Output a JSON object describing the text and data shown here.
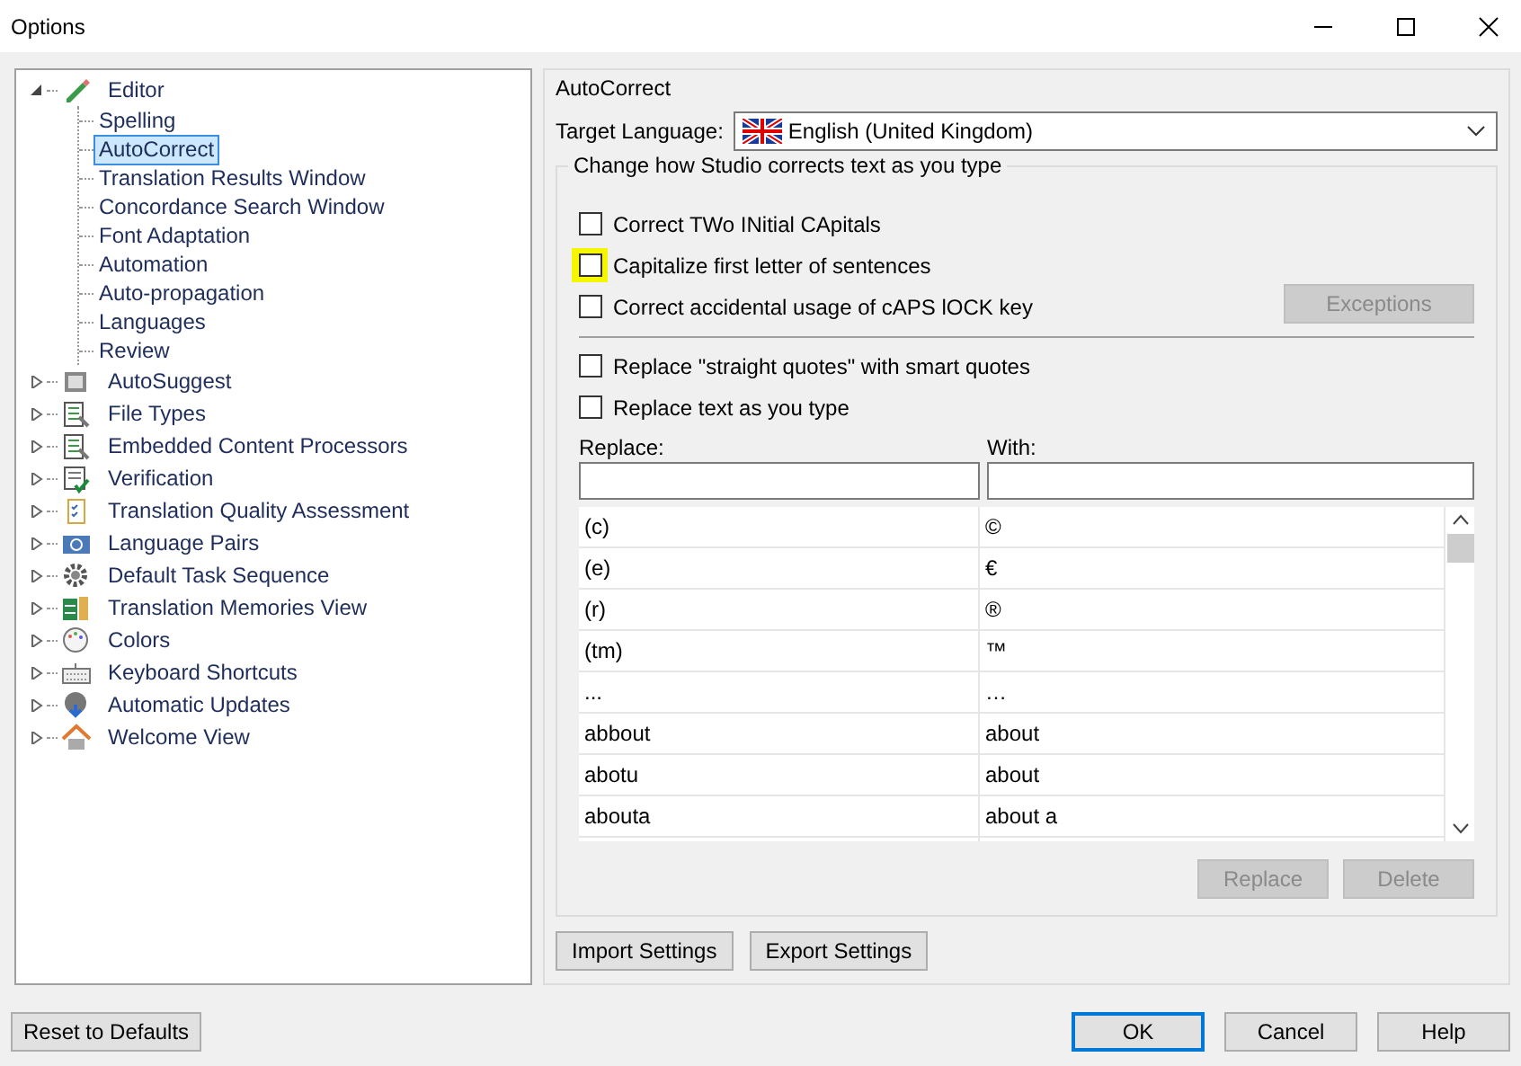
{
  "window": {
    "title": "Options"
  },
  "tree": [
    {
      "label": "Editor",
      "expanded": true,
      "selected": false,
      "children": [
        {
          "label": "Spelling",
          "selected": false
        },
        {
          "label": "AutoCorrect",
          "selected": true
        },
        {
          "label": "Translation Results Window",
          "selected": false
        },
        {
          "label": "Concordance Search Window",
          "selected": false
        },
        {
          "label": "Font Adaptation",
          "selected": false
        },
        {
          "label": "Automation",
          "selected": false
        },
        {
          "label": "Auto-propagation",
          "selected": false
        },
        {
          "label": "Languages",
          "selected": false
        },
        {
          "label": "Review",
          "selected": false
        }
      ]
    },
    {
      "label": "AutoSuggest",
      "expanded": false,
      "selected": false
    },
    {
      "label": "File Types",
      "expanded": false,
      "selected": false
    },
    {
      "label": "Embedded Content Processors",
      "expanded": false,
      "selected": false
    },
    {
      "label": "Verification",
      "expanded": false,
      "selected": false
    },
    {
      "label": "Translation Quality Assessment",
      "expanded": false,
      "selected": false
    },
    {
      "label": "Language Pairs",
      "expanded": false,
      "selected": false
    },
    {
      "label": "Default Task Sequence",
      "expanded": false,
      "selected": false
    },
    {
      "label": "Translation Memories View",
      "expanded": false,
      "selected": false
    },
    {
      "label": "Colors",
      "expanded": false,
      "selected": false
    },
    {
      "label": "Keyboard Shortcuts",
      "expanded": false,
      "selected": false
    },
    {
      "label": "Automatic Updates",
      "expanded": false,
      "selected": false
    },
    {
      "label": "Welcome View",
      "expanded": false,
      "selected": false
    }
  ],
  "autocorrect": {
    "title": "AutoCorrect",
    "target_language_label": "Target Language:",
    "target_language": "English (United Kingdom)",
    "group_title": "Change how Studio corrects text as you type",
    "options": [
      {
        "label": "Correct TWo INitial CApitals",
        "checked": false,
        "highlighted": false
      },
      {
        "label": "Capitalize first letter of sentences",
        "checked": false,
        "highlighted": true
      },
      {
        "label": "Correct accidental usage of cAPS lOCK key",
        "checked": false,
        "highlighted": false
      }
    ],
    "exceptions_button": {
      "label": "Exceptions",
      "disabled": true
    },
    "options_2": [
      {
        "label": "Replace \"straight quotes\" with smart quotes",
        "checked": false
      },
      {
        "label": "Replace text as you type",
        "checked": false
      }
    ],
    "replace_label": "Replace:",
    "with_label": "With:",
    "table": {
      "rows": [
        [
          "(c)",
          "©"
        ],
        [
          "(e)",
          "€"
        ],
        [
          "(r)",
          "®"
        ],
        [
          "(tm)",
          "™"
        ],
        [
          "...",
          "…"
        ],
        [
          "abbout",
          "about"
        ],
        [
          "abotu",
          "about"
        ],
        [
          "abouta",
          "about a"
        ]
      ]
    },
    "table_buttons": [
      {
        "label": "Replace",
        "disabled": true
      },
      {
        "label": "Delete",
        "disabled": true
      }
    ],
    "settings_buttons": [
      "Import Settings",
      "Export Settings"
    ]
  },
  "footer": {
    "reset_button": "Reset to Defaults",
    "buttons": [
      {
        "label": "OK",
        "default": true
      },
      {
        "label": "Cancel",
        "default": false
      },
      {
        "label": "Help",
        "default": false
      }
    ]
  }
}
